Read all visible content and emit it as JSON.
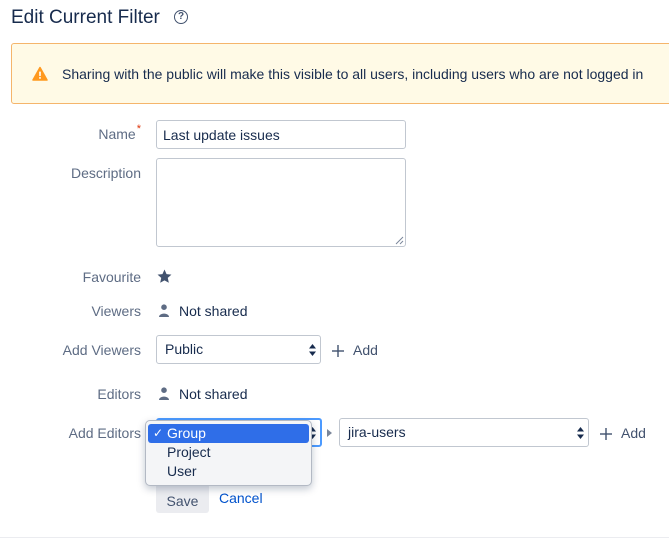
{
  "header": {
    "title": "Edit Current Filter",
    "help_icon": "question-circle-icon",
    "help_glyph": "?"
  },
  "warning": {
    "icon": "warning-icon",
    "text": "Sharing with the public will make this visible to all users, including users who are not logged in"
  },
  "form": {
    "name": {
      "label": "Name",
      "required_marker": "*",
      "value": "Last update issues"
    },
    "description": {
      "label": "Description",
      "value": ""
    },
    "favourite": {
      "label": "Favourite",
      "icon": "star-icon"
    },
    "viewers": {
      "label": "Viewers",
      "icon": "user-icon",
      "value": "Not shared"
    },
    "add_viewers": {
      "label": "Add Viewers",
      "selected": "Public",
      "add_label": "Add"
    },
    "editors": {
      "label": "Editors",
      "icon": "user-icon",
      "value": "Not shared"
    },
    "add_editors": {
      "label": "Add Editors",
      "type_options": [
        "Group",
        "Project",
        "User"
      ],
      "selected_type": "Group",
      "check_glyph": "✓",
      "group_value": "jira-users",
      "add_label": "Add"
    }
  },
  "actions": {
    "save_label": "Save",
    "cancel_label": "Cancel"
  },
  "colors": {
    "warning_bg": "#fffae6",
    "warning_border": "#f5b56b",
    "warning_icon": "#ff991f",
    "link": "#0052cc",
    "focus": "#4c9aff",
    "selected_option": "#2f6ee8",
    "required": "#de350b"
  }
}
